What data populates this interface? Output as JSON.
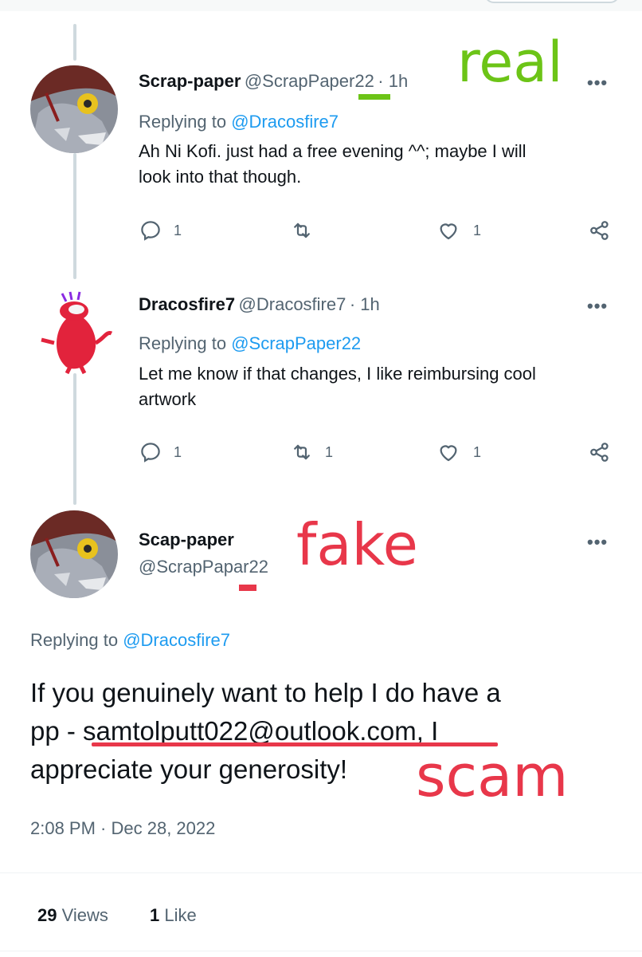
{
  "tweets": [
    {
      "name": "Scrap-paper",
      "handle": "@ScrapPaper22",
      "time": "· 1h",
      "replying_prefix": "Replying to ",
      "replying_mention": "@Dracosfire7",
      "text_line1": "Ah Ni Kofi. just had a free evening ^^; maybe I will",
      "text_line2": "look into that though.",
      "reply_count": "1",
      "retweet_count": "",
      "like_count": "1"
    },
    {
      "name": "Dracosfire7",
      "handle": "@Dracosfire7",
      "time": "· 1h",
      "replying_prefix": "Replying to ",
      "replying_mention": "@ScrapPaper22",
      "text_line1": "Let me know if that changes, I like reimbursing cool",
      "text_line2": "artwork",
      "reply_count": "1",
      "retweet_count": "1",
      "like_count": "1"
    }
  ],
  "main_tweet": {
    "name": "Scap-paper",
    "handle": "@ScrapPapar22",
    "replying_prefix": "Replying to ",
    "replying_mention": "@Dracosfire7",
    "text_line1": "If you genuinely want to help I do have a",
    "text_line2_prefix": "pp - ",
    "text_line2_email": "samtolputt022@outlook.com",
    "text_line2_suffix": ", I",
    "text_line3": "appreciate your generosity!",
    "timestamp": "2:08 PM · Dec 28, 2022",
    "views_count": "29",
    "views_label": " Views",
    "likes_count": "1",
    "likes_label": " Like"
  },
  "annotations": {
    "real": "real",
    "fake": "fake",
    "scam": "scam",
    "real_color": "#6cc417",
    "fake_color": "#e8374a",
    "scam_color": "#e8374a"
  },
  "icons": {
    "reply": "reply-icon",
    "retweet": "retweet-icon",
    "like": "heart-icon",
    "share": "share-icon",
    "more": "more-icon"
  },
  "colors": {
    "link": "#1d9bf0",
    "secondary_text": "#536471"
  }
}
